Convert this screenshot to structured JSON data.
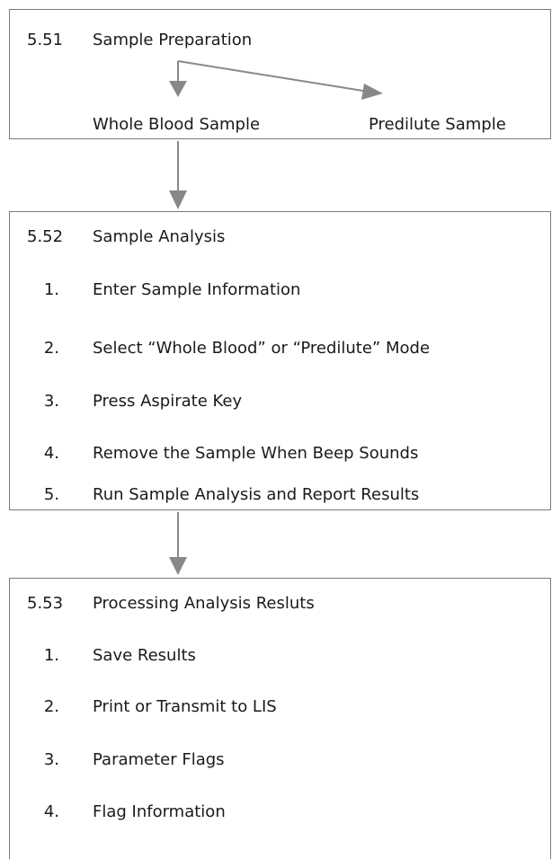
{
  "section1": {
    "number": "5.51",
    "title": "Sample Preparation",
    "options": [
      "Whole Blood Sample",
      "Predilute Sample"
    ]
  },
  "section2": {
    "number": "5.52",
    "title": "Sample Analysis",
    "steps": [
      {
        "num": "1.",
        "text": "Enter Sample Information"
      },
      {
        "num": "2.",
        "text": "Select “Whole Blood” or “Predilute” Mode"
      },
      {
        "num": "3.",
        "text": "Press Aspirate Key"
      },
      {
        "num": "4.",
        "text": "Remove the Sample When Beep Sounds"
      },
      {
        "num": "5.",
        "text": "Run Sample Analysis and Report Results"
      }
    ]
  },
  "section3": {
    "number": "5.53",
    "title": "Processing Analysis Resluts",
    "steps": [
      {
        "num": "1.",
        "text": "Save Results"
      },
      {
        "num": "2.",
        "text": "Print or Transmit to LIS"
      },
      {
        "num": "3.",
        "text": "Parameter Flags"
      },
      {
        "num": "4.",
        "text": "Flag Information"
      }
    ]
  },
  "colors": {
    "border": "#7a7a7a",
    "arrow": "#888888",
    "text": "#1a1a1a"
  }
}
